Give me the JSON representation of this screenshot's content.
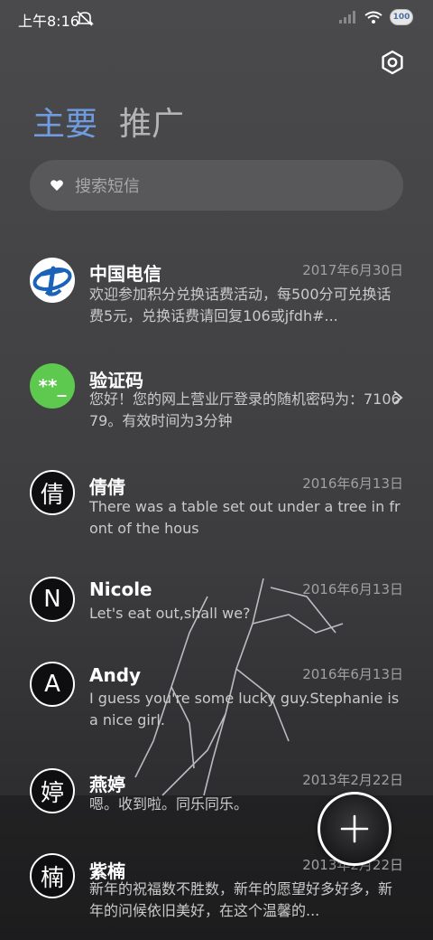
{
  "status_bar": {
    "time": "上午8:16",
    "battery_level": "100"
  },
  "tabs": [
    {
      "label": "主要",
      "active": true
    },
    {
      "label": "推广",
      "active": false
    }
  ],
  "search": {
    "placeholder": "搜索短信"
  },
  "conversations": [
    {
      "name": "中国电信",
      "date": "2017年6月30日",
      "preview": "欢迎参加积分兑换话费活动，每500分可兑换话费5元，兑换话费请回复106或jfdh#...",
      "avatar": "telecom-logo"
    },
    {
      "name": "验证码",
      "date": "",
      "preview": "您好！您的网上营业厅登录的随机密码为：710679。有效时间为3分钟",
      "avatar_text": "**_"
    },
    {
      "name": "倩倩",
      "date": "2016年6月13日",
      "preview": "There was a table set out under a tree in front of the hous",
      "avatar_text": "倩"
    },
    {
      "name": "Nicole",
      "date": "2016年6月13日",
      "preview": "Let's eat out,shall we?",
      "avatar_text": "N"
    },
    {
      "name": "Andy",
      "date": "2016年6月13日",
      "preview": "I guess you're some lucky guy.Stephanie is a nice girl.",
      "avatar_text": "A"
    },
    {
      "name": "燕婷",
      "date": "2013年2月22日",
      "preview": "嗯。收到啦。同乐同乐。",
      "avatar_text": "婷"
    },
    {
      "name": "紫楠",
      "date": "2013年2月22日",
      "preview": "新年的祝福数不胜数，新年的愿望好多好多，新年的问候依旧美好，在这个温馨的...",
      "avatar_text": "楠"
    }
  ],
  "colors": {
    "active_tab": "#6f9be0",
    "verification_avatar": "#5ec94f",
    "telecom_blue": "#1a63b8"
  }
}
